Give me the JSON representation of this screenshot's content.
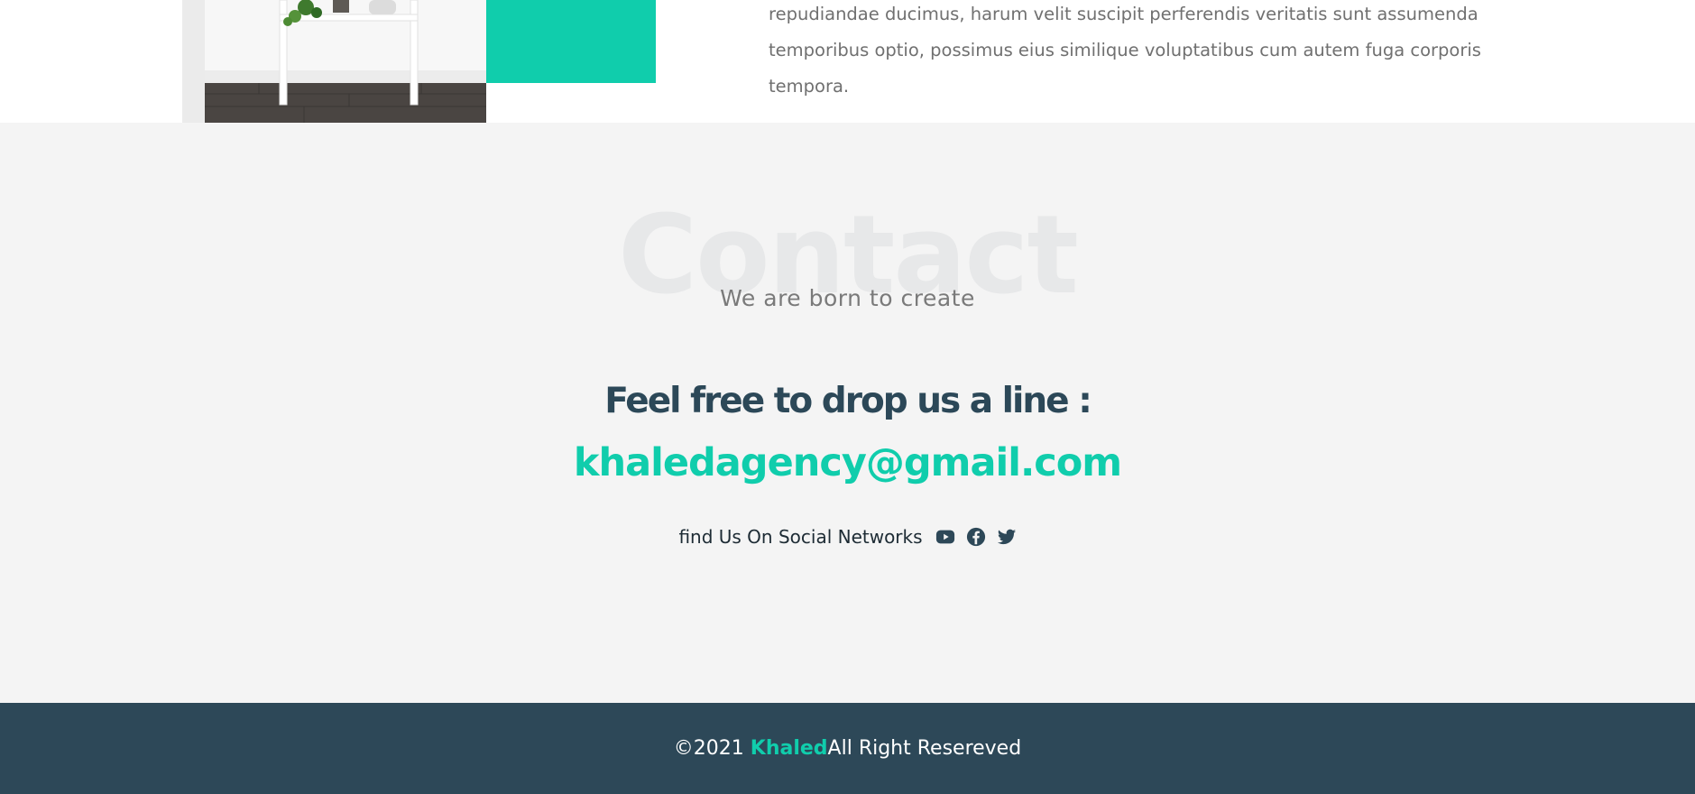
{
  "about": {
    "paragraph_lines": [
      "repudiandae ducimus, harum velit suscipit perferendis veritatis sunt assumenda",
      "temporibus optio, possimus eius similique voluptatibus cum autem fuga corporis",
      "tempora."
    ]
  },
  "contact": {
    "watermark": "Contact",
    "subtitle": "We are born to create",
    "headline": "Feel free to drop us a line :",
    "email": "khaledagency@gmail.com",
    "social_label": "find Us On Social Networks",
    "social_icons": [
      "youtube-icon",
      "facebook-icon",
      "twitter-icon"
    ]
  },
  "footer": {
    "copyright": "©2021 ",
    "brand": "Khaled",
    "rights": "All Right Resereved"
  },
  "colors": {
    "accent": "#10cdac",
    "dark": "#2d4858",
    "section_bg": "#f4f4f4",
    "body_text": "#707070"
  }
}
